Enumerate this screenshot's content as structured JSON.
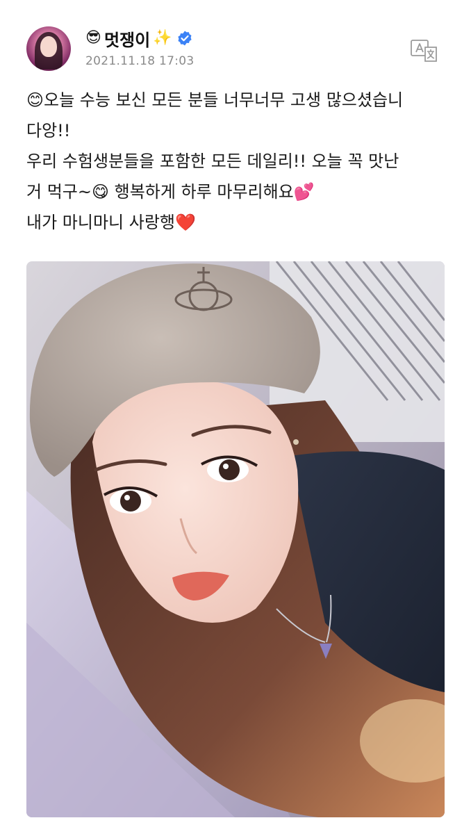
{
  "post": {
    "author": {
      "emoji": "😎",
      "name": "멋쟁이",
      "sparkle": "✨",
      "verified_icon": "verified-badge-icon"
    },
    "timestamp": "2021.11.18 17:03",
    "translate_icon": "translate-icon",
    "text_lines": [
      "😊오늘 수능 보신 모든 분들 너무너무 고생 많으셨습니",
      "다앙!!",
      "우리 수험생분들을 포함한 모든 데일리!! 오늘 꼭 맛난",
      "거 먹구~😋 행복하게 하루 마무리해요💕",
      "내가 마니마니 사랑행❤️"
    ],
    "photo": {
      "description_icon": "selfie-photo"
    }
  },
  "colors": {
    "accent_verified": "#3b82f6",
    "timestamp": "#8a8a8a",
    "text": "#1a1a1a"
  }
}
